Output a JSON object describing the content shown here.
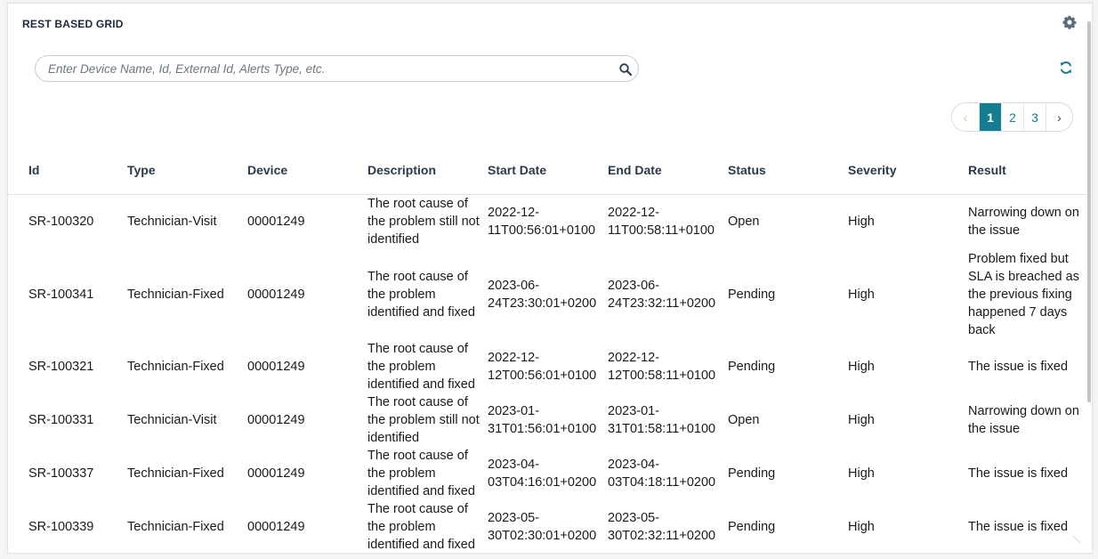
{
  "widget": {
    "title": "REST BASED GRID"
  },
  "search": {
    "placeholder": "Enter Device Name, Id, External Id, Alerts Type, etc."
  },
  "pagination": {
    "prev": "‹",
    "pages": [
      "1",
      "2",
      "3"
    ],
    "current": "1",
    "next": "›"
  },
  "table": {
    "columns": [
      "Id",
      "Type",
      "Device",
      "Description",
      "Start Date",
      "End Date",
      "Status",
      "Severity",
      "Result"
    ],
    "rows": [
      [
        "SR-100320",
        "Technician-Visit",
        "00001249",
        "The root cause of the problem still not identified",
        "2022-12-11T00:56:01+0100",
        "2022-12-11T00:58:11+0100",
        "Open",
        "High",
        "Narrowing down on the issue"
      ],
      [
        "SR-100341",
        "Technician-Fixed",
        "00001249",
        "The root cause of the problem identified and fixed",
        "2023-06-24T23:30:01+0200",
        "2023-06-24T23:32:11+0200",
        "Pending",
        "High",
        "Problem fixed but SLA is breached as the previous fixing happened 7 days back"
      ],
      [
        "SR-100321",
        "Technician-Fixed",
        "00001249",
        "The root cause of the problem identified and fixed",
        "2022-12-12T00:56:01+0100",
        "2022-12-12T00:58:11+0100",
        "Pending",
        "High",
        "The issue is fixed"
      ],
      [
        "SR-100331",
        "Technician-Visit",
        "00001249",
        "The root cause of the problem still not identified",
        "2023-01-31T01:56:01+0100",
        "2023-01-31T01:58:11+0100",
        "Open",
        "High",
        "Narrowing down on the issue"
      ],
      [
        "SR-100337",
        "Technician-Fixed",
        "00001249",
        "The root cause of the problem identified and fixed",
        "2023-04-03T04:16:01+0200",
        "2023-04-03T04:18:11+0200",
        "Pending",
        "High",
        "The issue is fixed"
      ],
      [
        "SR-100339",
        "Technician-Fixed",
        "00001249",
        "The root cause of the problem identified and fixed",
        "2023-05-30T02:30:01+0200",
        "2023-05-30T02:32:11+0200",
        "Pending",
        "High",
        "The issue is fixed"
      ]
    ]
  },
  "icons": {
    "settings": "gear-icon",
    "search": "search-icon",
    "refresh": "refresh-icon",
    "resize": "resize-handle-icon"
  },
  "colors": {
    "accent": "#137d91",
    "header_text": "#2b3a4a",
    "border": "#dfe2e6"
  }
}
